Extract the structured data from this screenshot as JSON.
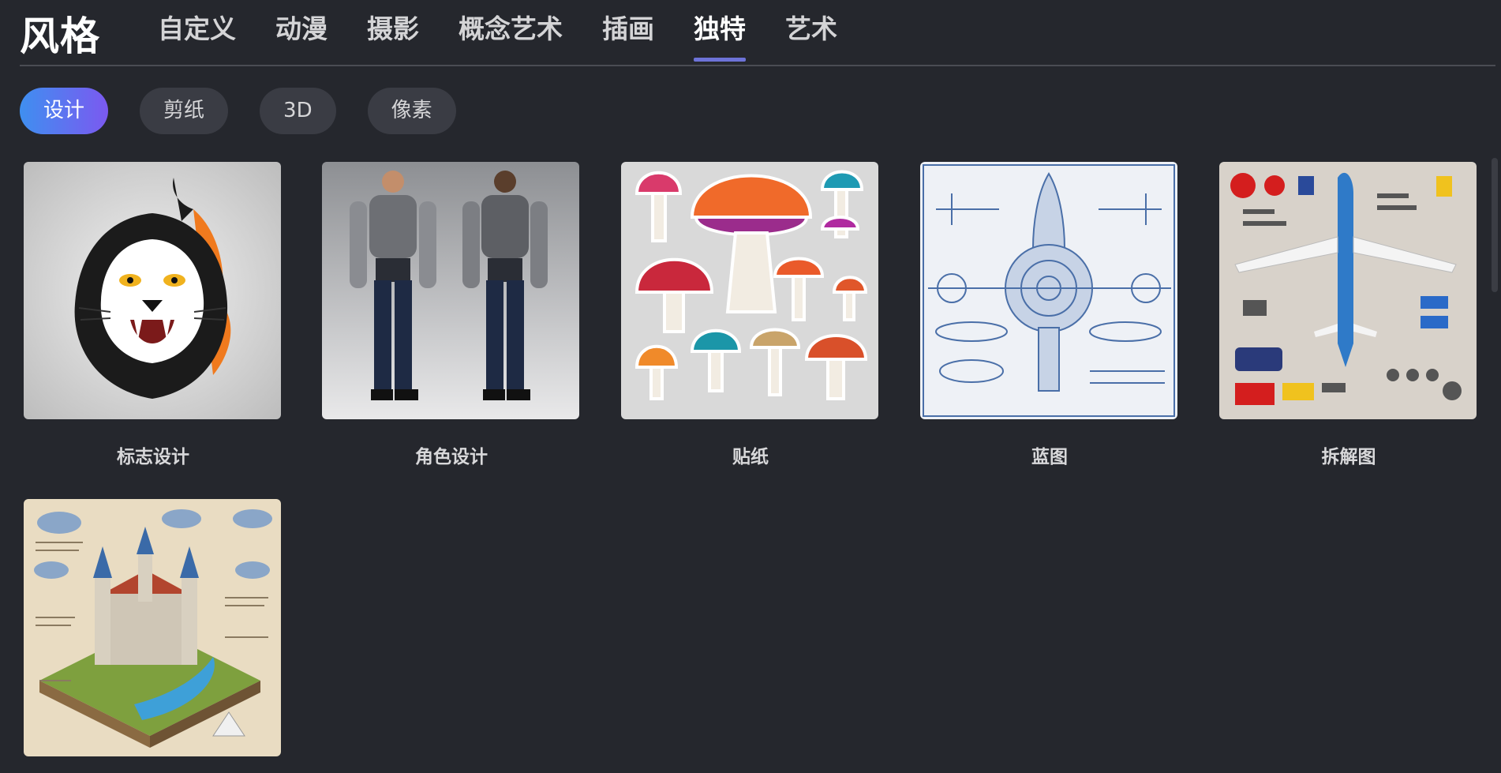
{
  "header": {
    "title": "风格",
    "tabs": [
      {
        "label": "自定义"
      },
      {
        "label": "动漫"
      },
      {
        "label": "摄影"
      },
      {
        "label": "概念艺术"
      },
      {
        "label": "插画"
      },
      {
        "label": "独特",
        "active": true
      },
      {
        "label": "艺术"
      }
    ]
  },
  "chips": [
    {
      "label": "设计",
      "active": true
    },
    {
      "label": "剪纸"
    },
    {
      "label": "3D"
    },
    {
      "label": "像素"
    }
  ],
  "styles": [
    {
      "label": "标志设计",
      "image": "panther-logo-image"
    },
    {
      "label": "角色设计",
      "image": "robot-character-sheet-image"
    },
    {
      "label": "贴纸",
      "image": "mushroom-stickers-image"
    },
    {
      "label": "蓝图",
      "image": "spaceship-blueprint-image"
    },
    {
      "label": "拆解图",
      "image": "airplane-knolling-image"
    },
    {
      "label": "",
      "image": "castle-map-image"
    }
  ],
  "colors": {
    "background": "#25272d",
    "accent": "#6d73d8",
    "chip_active_start": "#3f8ff0",
    "chip_active_end": "#7b59f0"
  }
}
